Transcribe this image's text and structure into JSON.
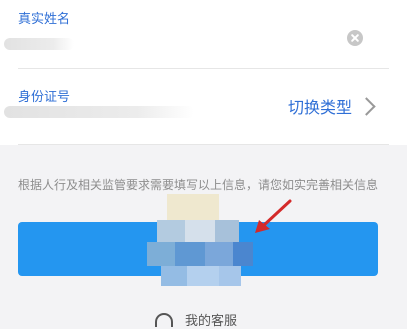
{
  "form": {
    "name_label": "真实姓名",
    "id_label": "身份证号",
    "switch_type_label": "切换类型"
  },
  "notice": {
    "text": "根据人行及相关监管要求需要填写以上信息，请您如实完善相关信息"
  },
  "footer": {
    "customer_service_label": "我的客服"
  },
  "colors": {
    "accent": "#2f6fd6",
    "button": "#2496f0",
    "annotation_arrow": "#d42a2a"
  },
  "icons": {
    "clear": "clear-icon",
    "chevron": "chevron-right-icon",
    "headset": "headset-icon",
    "arrow": "red-arrow-icon"
  }
}
